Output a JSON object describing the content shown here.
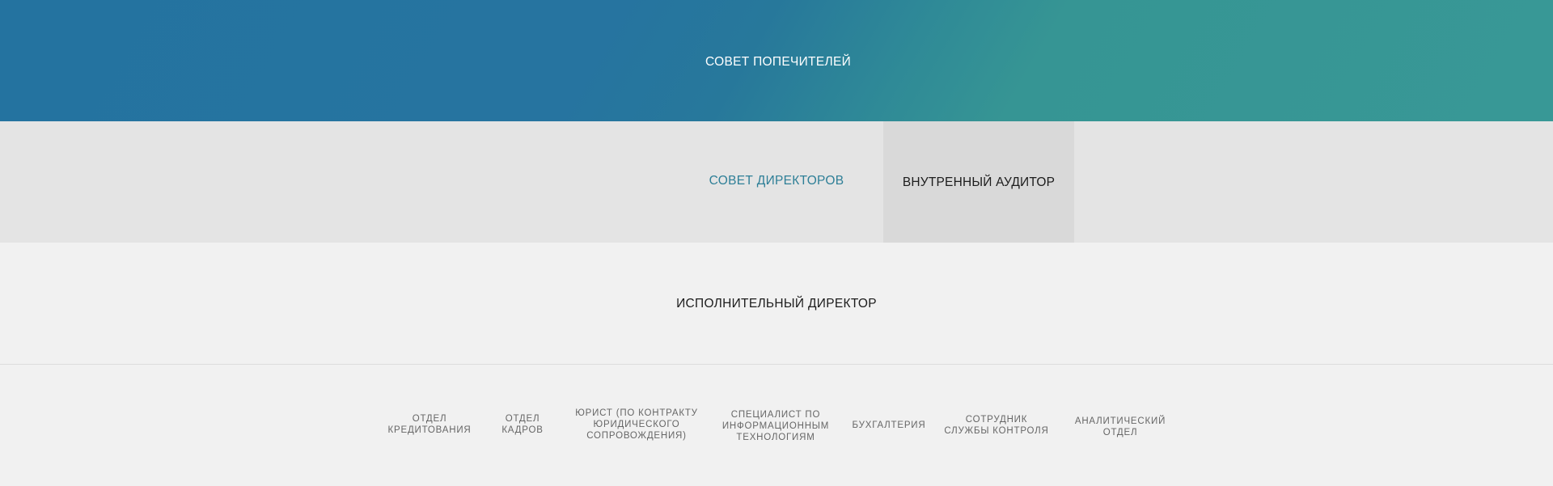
{
  "trustees": {
    "label": "СОВЕТ ПОПЕЧИТЕЛЕЙ"
  },
  "board": {
    "directors_label": "СОВЕТ ДИРЕКТОРОВ",
    "auditor_label": "ВНУТРЕННЫЙ АУДИТОР"
  },
  "executive": {
    "label": "ИСПОЛНИТЕЛЬНЫЙ ДИРЕКТОР"
  },
  "departments": [
    {
      "label": "ОТДЕЛ\nКРЕДИТОВАНИЯ"
    },
    {
      "label": "ОТДЕЛ\nКАДРОВ"
    },
    {
      "label": "ЮРИСТ (ПО КОНТРАКТУ\nЮРИДИЧЕСКОГО\nСОПРОВОЖДЕНИЯ)"
    },
    {
      "label": "СПЕЦИАЛИСТ ПО\nИНФОРМАЦИОННЫМ\nТЕХНОЛОГИЯМ"
    },
    {
      "label": "БУХГАЛТЕРИЯ"
    },
    {
      "label": "СОТРУДНИК\nСЛУЖБЫ КОНТРОЛЯ"
    },
    {
      "label": "АНАЛИТИЧЕСКИЙ\nОТДЕЛ"
    }
  ],
  "colors": {
    "trustees_gradient_start": "#2473a0",
    "trustees_gradient_end": "#389896",
    "directors_text": "#2e7f97",
    "board_background": "#e4e4e4",
    "auditor_background": "#d9d9d9",
    "page_background": "#f1f1f1"
  }
}
